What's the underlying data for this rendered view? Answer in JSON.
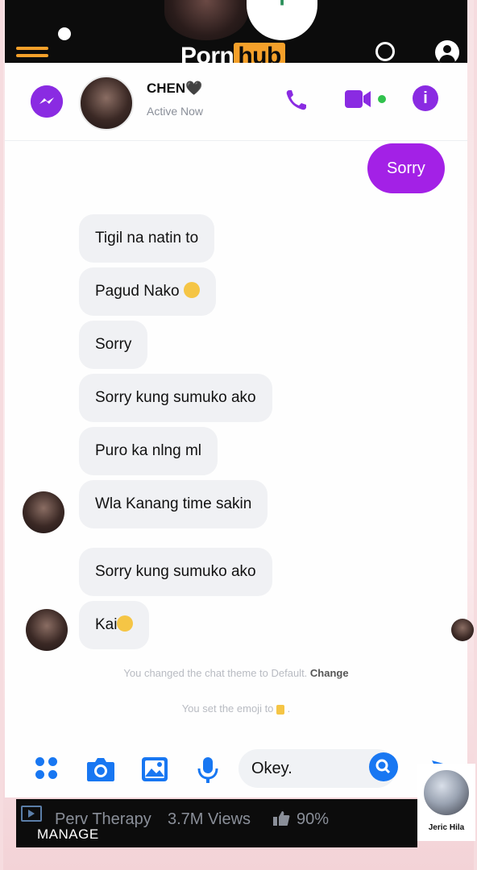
{
  "site": {
    "brand_prefix": "Porn",
    "brand_suffix": "hub",
    "accent": "#f5a02a"
  },
  "header": {
    "contact_name": "CHEN🖤",
    "status": "Active Now",
    "accent": "#8a2be2"
  },
  "messages": {
    "outgoing": [
      "Sorry"
    ],
    "incoming": [
      "Tigil na natin to",
      "Pagud Nako",
      "Sorry",
      "Sorry kung sumuko ako",
      "Puro ka nlng ml",
      "Wla Kanang time sakin",
      "Sorry kung sumuko ako",
      "Kai"
    ]
  },
  "system": {
    "theme_change": "You changed the chat theme to Default.",
    "change_link": "Change",
    "emoji_set": "You set the emoji to"
  },
  "composer": {
    "text": "Okey."
  },
  "video_bar": {
    "title": "Perv Therapy",
    "views": "3.7M Views",
    "rating": "90%",
    "manage": "MANAGE"
  },
  "watermark": {
    "name": "Jeric Hila"
  }
}
